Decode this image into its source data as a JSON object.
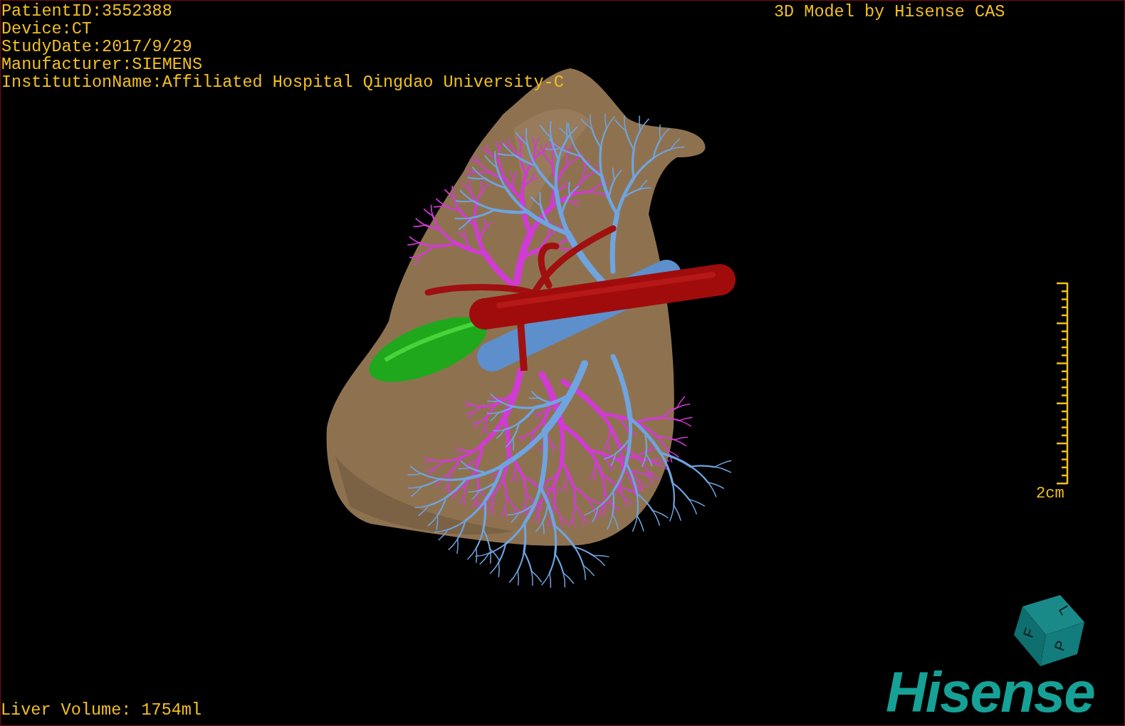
{
  "viewer": {
    "info_lines": [
      "PatientID:3552388",
      "Device:CT",
      "StudyDate:2017/9/29",
      "Manufacturer:SIEMENS",
      "InstitutionName:Affiliated Hospital Qingdao University-C"
    ],
    "title": "3D Model by Hisense CAS",
    "volume": "Liver Volume: 1754ml"
  },
  "scale_bar": {
    "label": "2cm"
  },
  "orientation_cube": {
    "faces": [
      "F",
      "L",
      "P"
    ]
  },
  "logo": "Hisense"
}
